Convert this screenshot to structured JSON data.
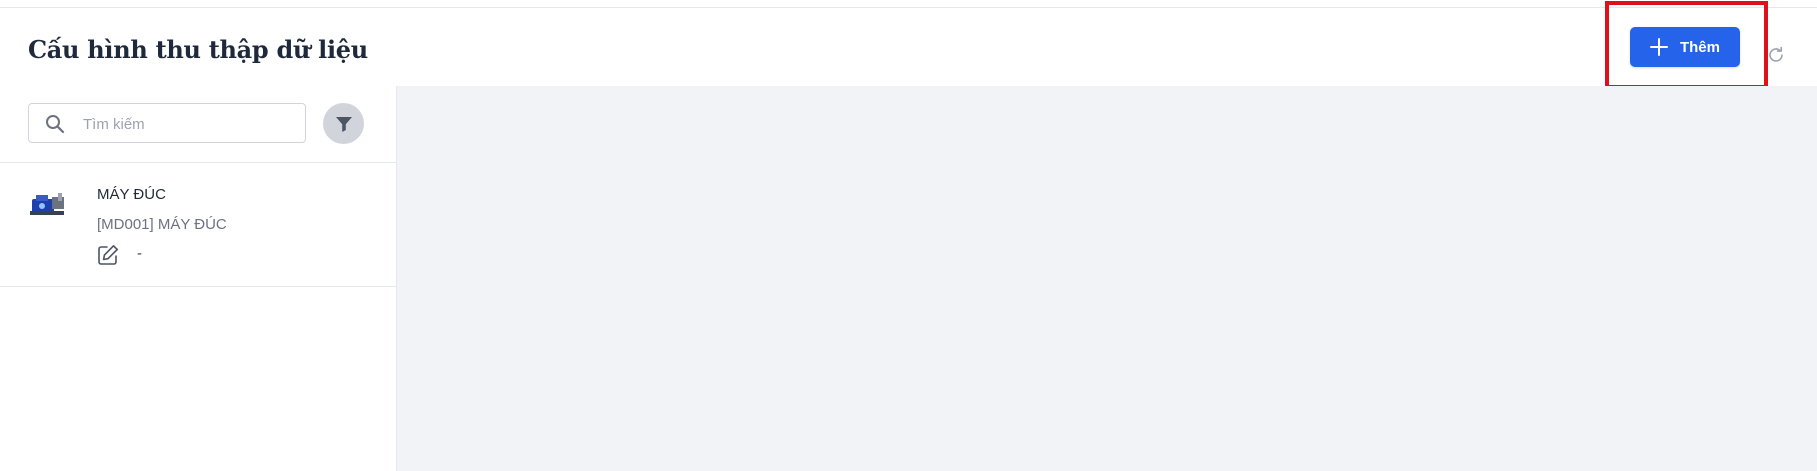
{
  "header": {
    "title": "Cấu hình thu thập dữ liệu",
    "add_label": "Thêm",
    "add_icon": "plus-icon",
    "refresh_icon": "refresh-icon",
    "accent_color": "#2563eb",
    "highlight_color": "#e0101a"
  },
  "search": {
    "placeholder": "Tìm kiếm",
    "value": "",
    "icon": "search-icon",
    "filter_icon": "filter-icon"
  },
  "list": {
    "items": [
      {
        "title": "MÁY ĐÚC",
        "subtitle": "[MD001] MÁY ĐÚC",
        "meta": "-",
        "thumbnail": "machine-image",
        "action_icon": "edit-icon"
      }
    ]
  }
}
